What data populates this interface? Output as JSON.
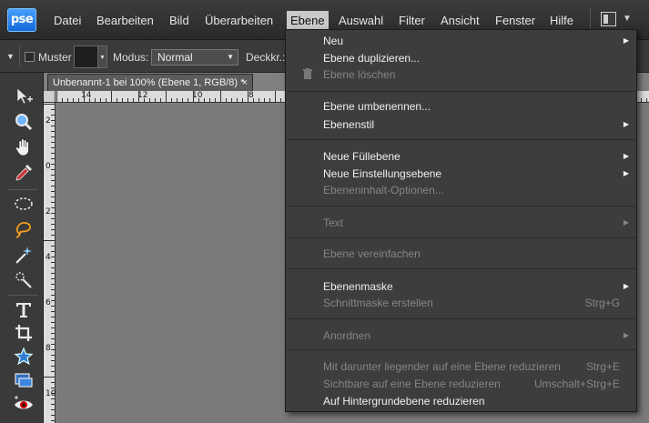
{
  "app": {
    "logo": "pse"
  },
  "menubar": {
    "items": [
      "Datei",
      "Bearbeiten",
      "Bild",
      "Überarbeiten",
      "Ebene",
      "Auswahl",
      "Filter",
      "Ansicht",
      "Fenster",
      "Hilfe"
    ],
    "active": "Ebene",
    "workspace_icon": "workspace-layout-icon"
  },
  "options_bar": {
    "muster_label": "Muster",
    "modus_label": "Modus:",
    "modus_value": "Normal",
    "deckkraft_label": "Deckkr.:"
  },
  "toolbox": {
    "tools": [
      "move-tool-icon",
      "zoom-tool-icon",
      "hand-tool-icon",
      "eyedropper-tool-icon",
      "marquee-tool-icon",
      "lasso-tool-icon",
      "magic-wand-tool-icon",
      "quick-selection-tool-icon",
      "type-tool-icon",
      "crop-tool-icon",
      "cookie-cutter-tool-icon",
      "straighten-tool-icon",
      "red-eye-tool-icon"
    ]
  },
  "document": {
    "tab_title": "Unbenannt-1 bei 100% (Ebene 1, RGB/8) *",
    "close_glyph": "×",
    "ruler_top_labels": [
      "14",
      "12",
      "10",
      "8"
    ],
    "ruler_left_labels": [
      "2",
      "0",
      "2",
      "4",
      "6",
      "8",
      "10"
    ]
  },
  "ebene_menu": {
    "items": [
      {
        "label": "Neu",
        "enabled": true,
        "submenu": true,
        "shortcut": ""
      },
      {
        "label": "Ebene duplizieren...",
        "enabled": true,
        "submenu": false,
        "shortcut": ""
      },
      {
        "label": "Ebene löschen",
        "enabled": false,
        "submenu": false,
        "shortcut": "",
        "icon": "trash-icon"
      },
      {
        "separator": true
      },
      {
        "label": "Ebene umbenennen...",
        "enabled": true,
        "submenu": false,
        "shortcut": ""
      },
      {
        "label": "Ebenenstil",
        "enabled": true,
        "submenu": true,
        "shortcut": ""
      },
      {
        "separator": true
      },
      {
        "label": "Neue Füllebene",
        "enabled": true,
        "submenu": true,
        "shortcut": ""
      },
      {
        "label": "Neue Einstellungsebene",
        "enabled": true,
        "submenu": true,
        "shortcut": ""
      },
      {
        "label": "Ebeneninhalt-Optionen...",
        "enabled": false,
        "submenu": false,
        "shortcut": ""
      },
      {
        "separator": true
      },
      {
        "label": "Text",
        "enabled": false,
        "submenu": true,
        "shortcut": ""
      },
      {
        "separator": true
      },
      {
        "label": "Ebene vereinfachen",
        "enabled": false,
        "submenu": false,
        "shortcut": ""
      },
      {
        "separator": true
      },
      {
        "label": "Ebenenmaske",
        "enabled": true,
        "submenu": true,
        "shortcut": ""
      },
      {
        "label": "Schnittmaske erstellen",
        "enabled": false,
        "submenu": false,
        "shortcut": "Strg+G"
      },
      {
        "separator": true
      },
      {
        "label": "Anordnen",
        "enabled": false,
        "submenu": true,
        "shortcut": ""
      },
      {
        "separator": true
      },
      {
        "label": "Mit darunter liegender auf eine Ebene reduzieren",
        "enabled": false,
        "submenu": false,
        "shortcut": "Strg+E"
      },
      {
        "label": "Sichtbare auf eine Ebene reduzieren",
        "enabled": false,
        "submenu": false,
        "shortcut": "Umschalt+Strg+E"
      },
      {
        "label": "Auf Hintergrundebene reduzieren",
        "enabled": true,
        "submenu": false,
        "shortcut": ""
      }
    ]
  }
}
